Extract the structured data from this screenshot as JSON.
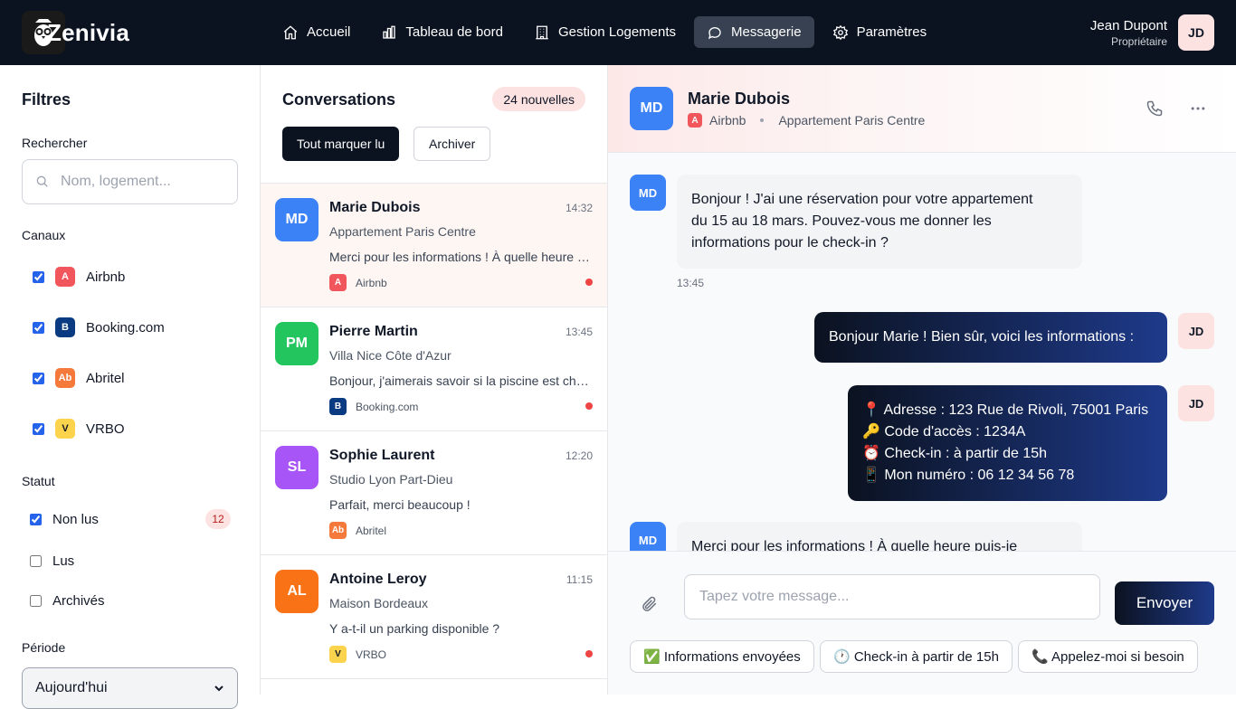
{
  "app": {
    "name": "Zenivia"
  },
  "nav": [
    {
      "label": "Accueil",
      "icon": "home-icon"
    },
    {
      "label": "Tableau de bord",
      "icon": "bar-chart-icon"
    },
    {
      "label": "Gestion Logements",
      "icon": "building-icon"
    },
    {
      "label": "Messagerie",
      "icon": "chat-icon",
      "active": true
    },
    {
      "label": "Paramètres",
      "icon": "gear-icon"
    }
  ],
  "user": {
    "name": "Jean Dupont",
    "role": "Propriétaire",
    "initials": "JD"
  },
  "filters": {
    "title": "Filtres",
    "search_label": "Rechercher",
    "search_placeholder": "Nom, logement...",
    "channels_label": "Canaux",
    "channels": [
      {
        "label": "Airbnb",
        "badge": "A",
        "color": "#f0565b",
        "checked": true
      },
      {
        "label": "Booking.com",
        "badge": "B",
        "color": "#0a3a82",
        "checked": true
      },
      {
        "label": "Abritel",
        "badge": "Ab",
        "color": "#f5793b",
        "checked": true
      },
      {
        "label": "VRBO",
        "badge": "V",
        "color": "#fcd34d",
        "checked": true
      }
    ],
    "status_label": "Statut",
    "statuses": [
      {
        "label": "Non lus",
        "checked": true,
        "count": "12"
      },
      {
        "label": "Lus",
        "checked": false
      },
      {
        "label": "Archivés",
        "checked": false
      }
    ],
    "period_label": "Période",
    "period_value": "Aujourd'hui"
  },
  "conversations": {
    "title": "Conversations",
    "new_count": "24 nouvelles",
    "mark_all_read": "Tout marquer lu",
    "archive": "Archiver",
    "items": [
      {
        "initials": "MD",
        "name": "Marie Dubois",
        "time": "14:32",
        "property": "Appartement Paris Centre",
        "preview": "Merci pour les informations ! À quelle heure puis-je",
        "channel": "Airbnb",
        "channel_badge": "A",
        "channel_color": "#f0565b",
        "avatar_color": "#3b82f6",
        "unread": true
      },
      {
        "initials": "PM",
        "name": "Pierre Martin",
        "time": "13:45",
        "property": "Villa Nice Côte d'Azur",
        "preview": "Bonjour, j'aimerais savoir si la piscine est chauffée",
        "channel": "Booking.com",
        "channel_badge": "B",
        "channel_color": "#0a3a82",
        "avatar_color": "#22c55e",
        "unread": true
      },
      {
        "initials": "SL",
        "name": "Sophie Laurent",
        "time": "12:20",
        "property": "Studio Lyon Part-Dieu",
        "preview": "Parfait, merci beaucoup !",
        "channel": "Abritel",
        "channel_badge": "Ab",
        "channel_color": "#f5793b",
        "avatar_color": "#a855f7",
        "unread": false
      },
      {
        "initials": "AL",
        "name": "Antoine Leroy",
        "time": "11:15",
        "property": "Maison Bordeaux",
        "preview": "Y a-t-il un parking disponible ?",
        "channel": "VRBO",
        "channel_badge": "V",
        "channel_color": "#fcd34d",
        "avatar_color": "#f97316",
        "unread": true
      }
    ]
  },
  "chat": {
    "contact_initials": "MD",
    "contact_name": "Marie Dubois",
    "channel_badge": "A",
    "channel": "Airbnb",
    "property": "Appartement Paris Centre",
    "messages": [
      {
        "from": "guest",
        "lines": [
          "Bonjour ! J'ai une réservation pour votre appartement",
          "du 15 au 18 mars. Pouvez-vous me donner les",
          "informations pour le check-in ?"
        ],
        "time": "13:45"
      },
      {
        "from": "host",
        "lines": [
          "Bonjour Marie ! Bien sûr, voici les informations :"
        ]
      },
      {
        "from": "host",
        "lines": [
          "📍 Adresse : 123 Rue de Rivoli, 75001 Paris",
          "🔑 Code d'accès : 1234A",
          "⏰ Check-in : à partir de 15h",
          "📱 Mon numéro : 06 12 34 56 78"
        ]
      },
      {
        "from": "guest",
        "lines": [
          "Merci pour les informations ! À quelle heure puis-je"
        ]
      }
    ],
    "input_placeholder": "Tapez votre message...",
    "send_label": "Envoyer",
    "quick_replies": [
      "✅ Informations envoyées",
      "🕐 Check-in à partir de 15h",
      "📞 Appelez-moi si besoin"
    ]
  }
}
